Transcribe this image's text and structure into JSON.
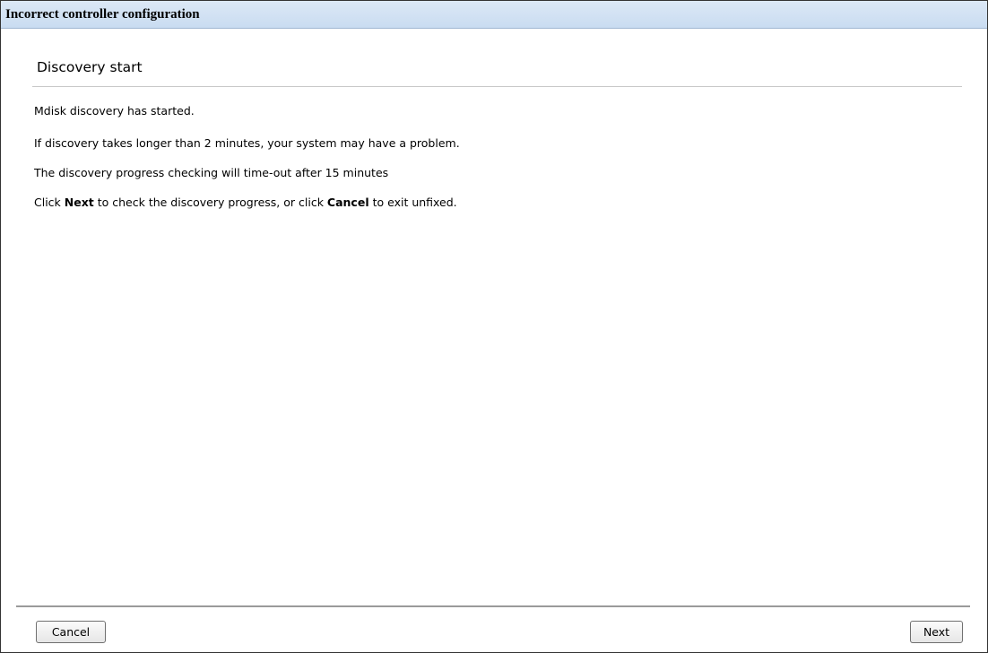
{
  "dialog": {
    "title": "Incorrect controller configuration"
  },
  "section": {
    "heading": "Discovery start"
  },
  "messages": {
    "line1": "Mdisk discovery has started.",
    "line2": "If discovery takes longer than 2 minutes, your system may have a problem.",
    "line3": "The discovery progress checking will time-out after 15 minutes",
    "line4": {
      "prefix": "Click ",
      "next_word": "Next",
      "middle": " to check the discovery progress, or click ",
      "cancel_word": "Cancel",
      "suffix": " to exit unfixed."
    }
  },
  "buttons": {
    "cancel_label": "Cancel",
    "next_label": "Next"
  },
  "colors": {
    "title_bar": "#c9dcf1",
    "border": "#333333",
    "rule": "#c8c8c8"
  }
}
